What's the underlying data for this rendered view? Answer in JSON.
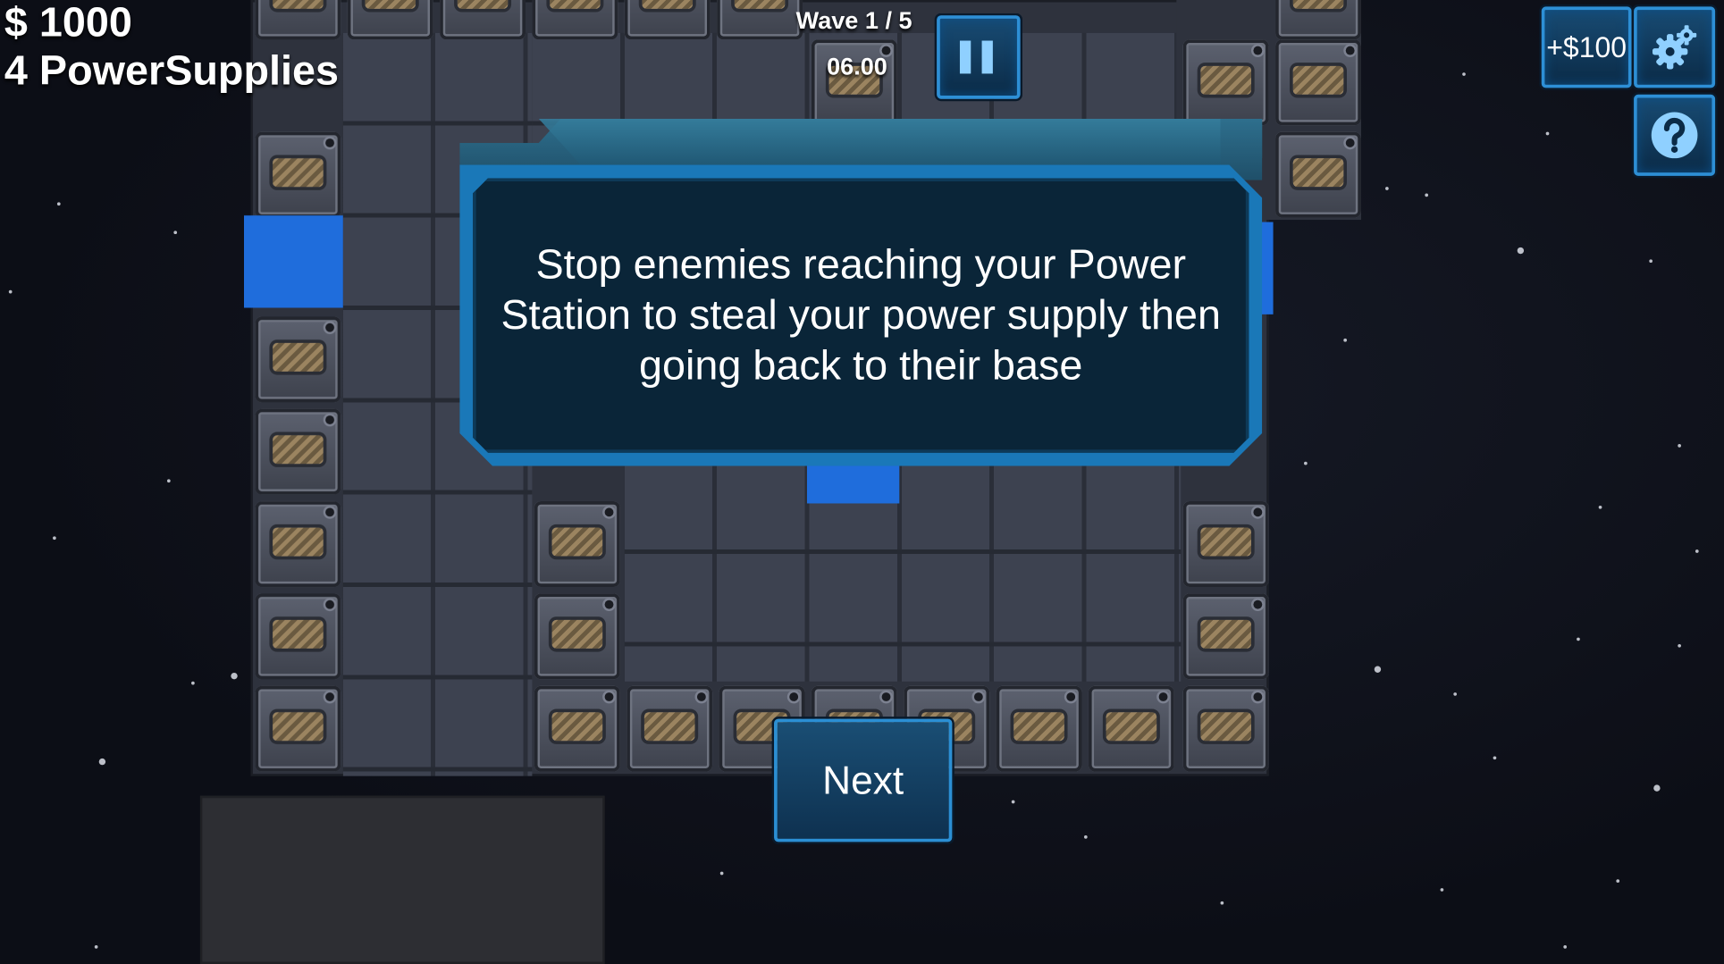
{
  "hud": {
    "money": "$ 1000",
    "power_supplies": "4 PowerSupplies",
    "wave": "Wave 1 / 5",
    "timer": "06.00"
  },
  "buttons": {
    "bonus_label": "+$100",
    "pause_icon": "pause-icon",
    "settings_icon": "gear-icon",
    "help_icon": "question-mark-icon"
  },
  "tutorial": {
    "message": "Stop enemies reaching your Power Station to steal your power supply then going back to their base",
    "next_label": "Next"
  },
  "colors": {
    "accent": "#2b8fd4",
    "panel_bg": "#0a2538",
    "lane_marker": "#1f6ddc"
  }
}
